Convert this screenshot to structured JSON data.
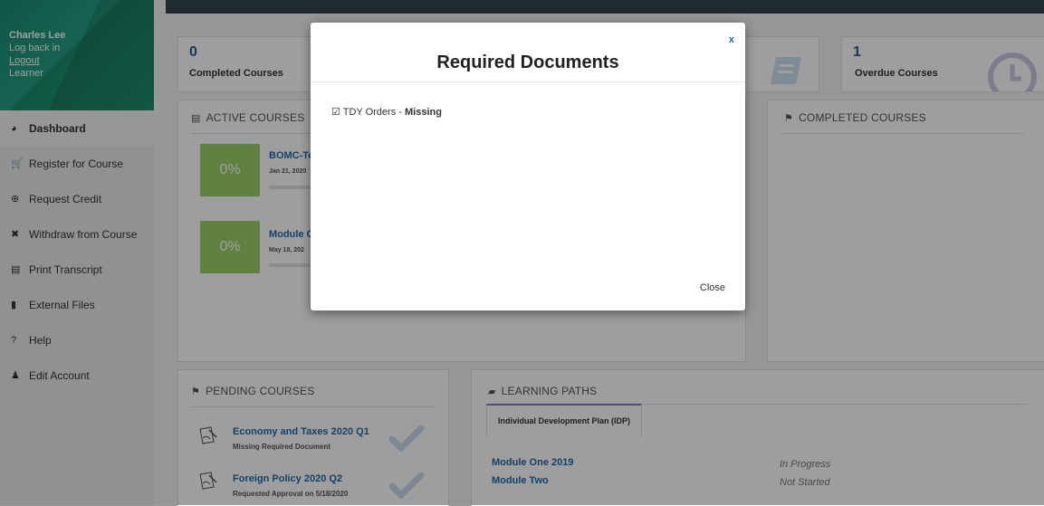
{
  "profile": {
    "name": "Charles Lee",
    "log_back": "Log back in",
    "logout": "Logout",
    "role": "Learner"
  },
  "nav": [
    {
      "label": "Dashboard",
      "icon": "◕",
      "active": true
    },
    {
      "label": "Register for Course",
      "icon": "🛒"
    },
    {
      "label": "Request Credit",
      "icon": "⊕"
    },
    {
      "label": "Withdraw from Course",
      "icon": "✖"
    },
    {
      "label": "Print Transcript",
      "icon": "▤"
    },
    {
      "label": "External Files",
      "icon": "▮"
    },
    {
      "label": "Help",
      "icon": "?"
    },
    {
      "label": "Edit Account",
      "icon": "♟"
    }
  ],
  "stats": {
    "completed": {
      "value": "0",
      "label": "Completed Courses"
    },
    "overdue": {
      "value": "1",
      "label": "Overdue Courses"
    }
  },
  "active_courses": {
    "heading": "ACTIVE COURSES",
    "items": [
      {
        "progress": "0%",
        "title": "BOMC-Te",
        "date": "Jan 21, 2020"
      },
      {
        "progress": "0%",
        "title": "Module C",
        "date": "May 18, 202"
      }
    ]
  },
  "completed_courses": {
    "heading": "COMPLETED COURSES"
  },
  "pending_courses": {
    "heading": "PENDING COURSES",
    "items": [
      {
        "title": "Economy and Taxes 2020 Q1",
        "subtitle": "Missing Required Document"
      },
      {
        "title": "Foreign Policy 2020 Q2",
        "subtitle": "Requested Approval on 5/18/2020"
      }
    ]
  },
  "learning_paths": {
    "heading": "LEARNING PATHS",
    "tab": "Individual Development Plan (IDP)",
    "rows": [
      {
        "title": "Module One 2019",
        "status": "In Progress"
      },
      {
        "title": "Module Two",
        "status": "Not Started"
      }
    ]
  },
  "modal": {
    "title": "Required Documents",
    "close_x": "x",
    "document_name": "TDY Orders - ",
    "document_status": "Missing",
    "close_label": "Close"
  },
  "colors": {
    "accent": "#1f6aa8",
    "sidebar_green": "#21a07f",
    "progress_green": "#9bd16b",
    "topbar": "#34464f"
  }
}
